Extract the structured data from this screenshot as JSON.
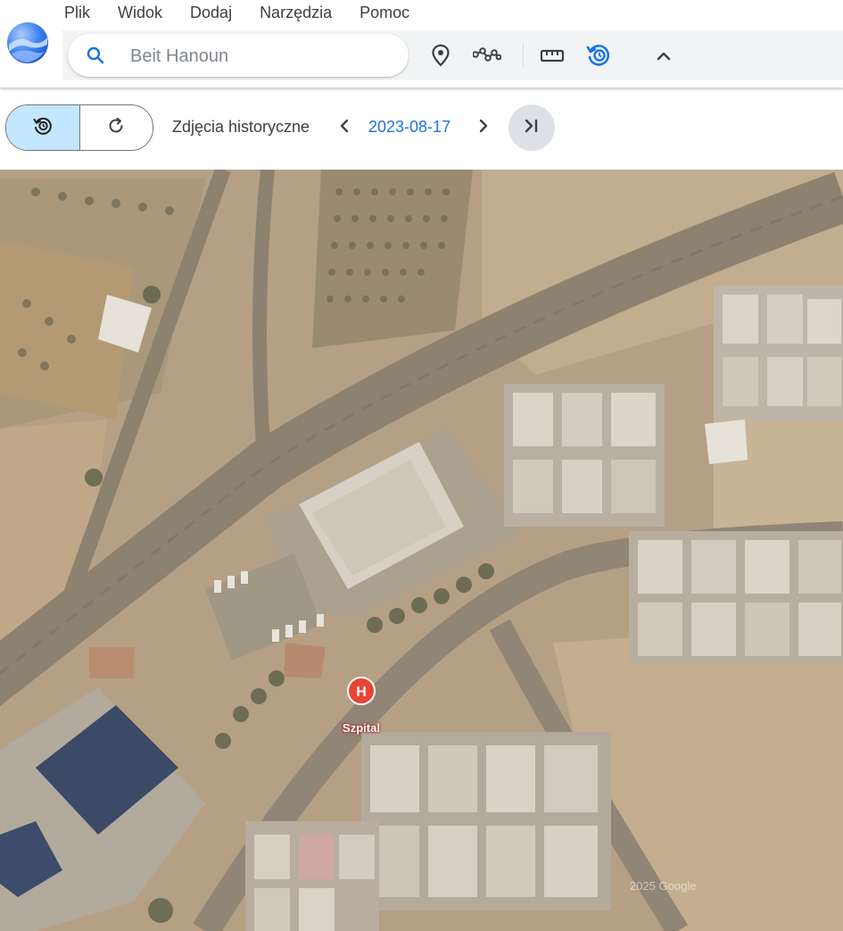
{
  "menu": {
    "items": [
      "Plik",
      "Widok",
      "Dodaj",
      "Narzędzia",
      "Pomoc"
    ]
  },
  "search": {
    "placeholder": "Beit Hanoun",
    "value": ""
  },
  "toolbar": {
    "icons": [
      "place-mark-icon",
      "path-icon",
      "ruler-icon",
      "historical-imagery-icon",
      "chevron-up-icon"
    ]
  },
  "historical": {
    "label": "Zdjęcia historyczne",
    "date": "2023-08-17"
  },
  "map": {
    "place_label": "Szpital",
    "watermark": "2025 Google"
  },
  "colors": {
    "accent": "#1a73e8",
    "segment_active": "#c2e7ff",
    "marker": "#ea4335"
  }
}
